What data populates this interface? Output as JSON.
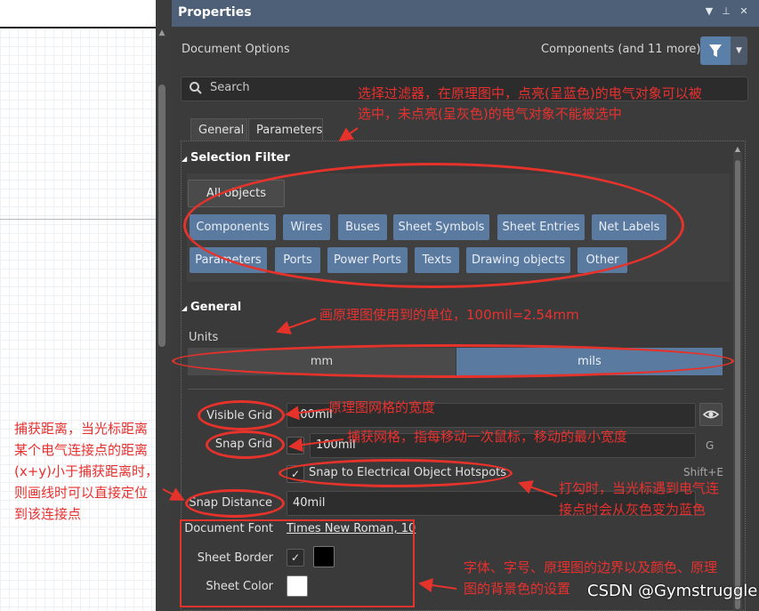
{
  "panel": {
    "title": "Properties",
    "titlebar_icons": [
      "dropdown-icon",
      "pin-icon",
      "close-icon"
    ],
    "document_options": "Document Options",
    "components_more": "Components (and 11 more)",
    "search_placeholder": "Search",
    "tabs": [
      {
        "label": "General",
        "active": true
      },
      {
        "label": "Parameters",
        "active": false
      }
    ]
  },
  "selection_filter": {
    "heading": "Selection Filter",
    "all_objects": "All objects",
    "buttons": [
      "Components",
      "Wires",
      "Buses",
      "Sheet Symbols",
      "Sheet Entries",
      "Net Labels",
      "Parameters",
      "Ports",
      "Power Ports",
      "Texts",
      "Drawing objects",
      "Other"
    ]
  },
  "general": {
    "heading": "General",
    "units_label": "Units",
    "unit_mm": "mm",
    "unit_mils": "mils",
    "selected_unit": "mils",
    "visible_grid_label": "Visible Grid",
    "visible_grid_value": "100mil",
    "snap_grid_label": "Snap Grid",
    "snap_grid_value": "100mil",
    "snap_grid_shortcut": "G",
    "snap_hotspots_label": "Snap to Electrical Object Hotspots",
    "snap_hotspots_shortcut": "Shift+E",
    "snap_distance_label": "Snap Distance",
    "snap_distance_value": "40mil",
    "document_font_label": "Document Font",
    "document_font_value": "Times New Roman, 10",
    "sheet_border_label": "Sheet Border",
    "sheet_color_label": "Sheet Color"
  },
  "annotations": {
    "filter_note_line1": "选择过滤器，在原理图中，点亮(呈蓝色)的电气对象可以被",
    "filter_note_line2": "选中，未点亮(呈灰色)的电气对象不能被选中",
    "units_note": "画原理图使用到的单位，100mil=2.54mm",
    "visible_grid_note": "原理图网格的宽度",
    "snap_grid_note": "捕获网格，指每移动一次鼠标，移动的最小宽度",
    "snap_distance_note": [
      "捕获距离，当光标距离",
      "某个电气连接点的距离",
      "(x+y)小于捕获距离时，",
      "则画线时可以直接定位",
      "到该连接点"
    ],
    "hotspot_note_line1": "打勾时，当光标遇到电气连",
    "hotspot_note_line2": "接点时会从灰色变为蓝色",
    "font_note_line1": "字体、字号、原理图的边界以及颜色、原理",
    "font_note_line2": "图的背景色的设置"
  },
  "watermark": "CSDN @Gymstruggle",
  "colors": {
    "titlebar": "#4d6078",
    "panel_bg": "#3b3b3b",
    "filter_active": "#5a7aa0",
    "annotation_red": "#e5332c",
    "sheet_border_swatch": "#000000",
    "sheet_color_swatch": "#ffffff"
  }
}
